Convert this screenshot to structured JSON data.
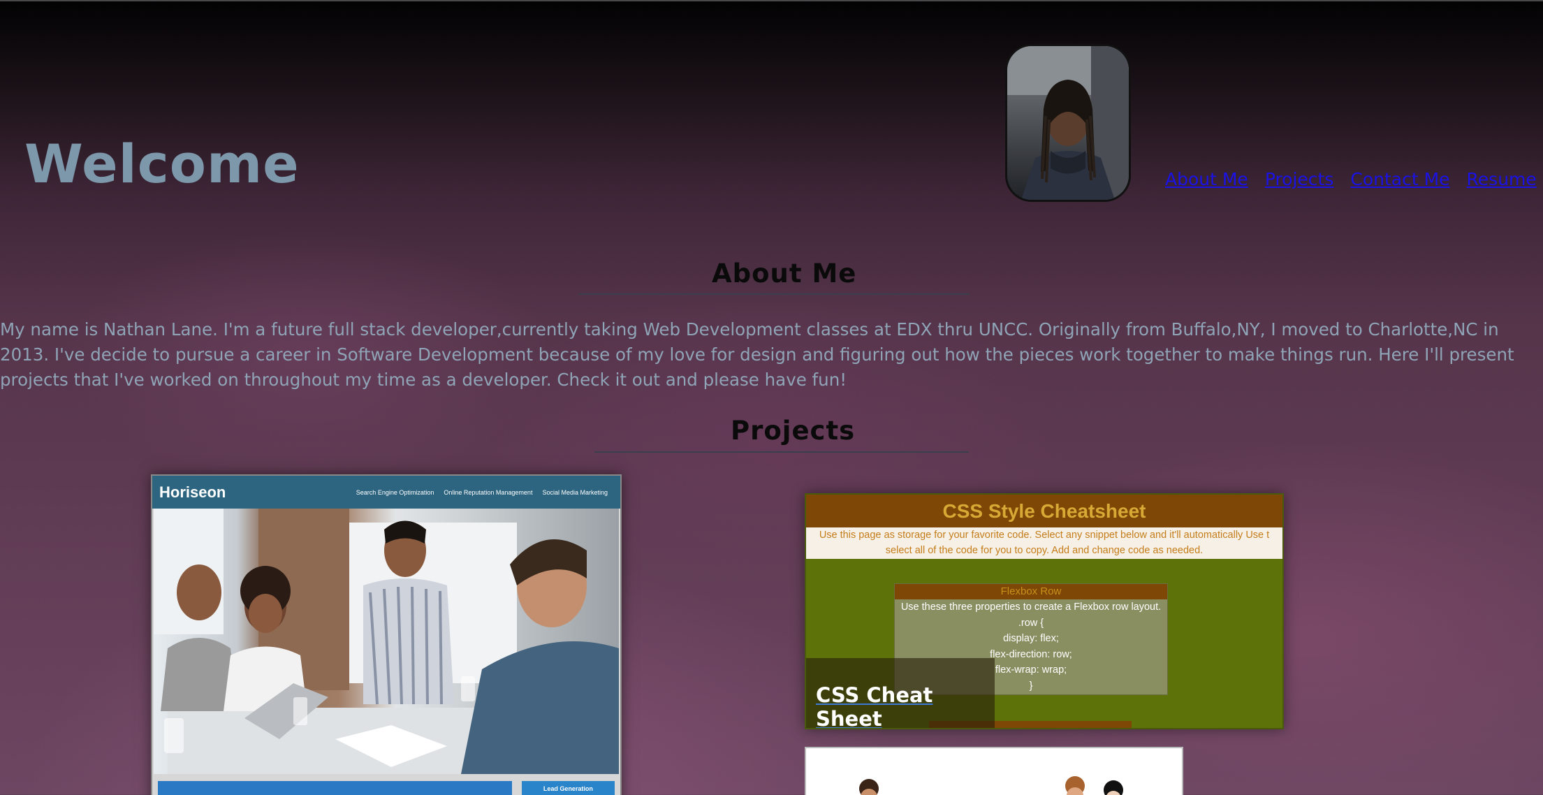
{
  "header": {
    "title": "Welcome",
    "nav": [
      "About Me",
      "Projects",
      "Contact Me",
      "Resume"
    ]
  },
  "about": {
    "heading": "About Me",
    "text": "My name is Nathan Lane. I'm a future full stack developer,currently taking Web Development classes at EDX thru UNCC. Originally from Buffalo,NY, I moved to Charlotte,NC in 2013. I've decide to pursue a career in Software Development because of my love for design and figuring out how the pieces work together to make things run. Here I'll present projects that I've worked on throughout my time as a developer. Check it out and please have fun!"
  },
  "projects": {
    "heading": "Projects",
    "horiseon": {
      "logo": "Horiseon",
      "links": [
        "Search Engine Optimization",
        "Online Reputation Management",
        "Social Media Marketing"
      ],
      "lead": "Lead Generation"
    },
    "cheatsheet": {
      "title": "CSS Style Cheatsheet",
      "desc_line1": "Use this page as storage for your favorite code. Select any snippet below and it'll automatically Use t",
      "desc_line2": "select all of the code for you to copy. Add and change code as needed.",
      "box_title": "Flexbox Row",
      "box_lines": [
        "Use these three properties to create a Flexbox row layout.",
        ".row {",
        "display: flex;",
        "flex-direction: row;",
        "flex-wrap: wrap;",
        "}"
      ],
      "label": "CSS Cheat Sheet"
    }
  },
  "colors": {
    "welcome": "#7d97ab",
    "link": "#1a12e6",
    "about_text": "#8fa4b6"
  }
}
